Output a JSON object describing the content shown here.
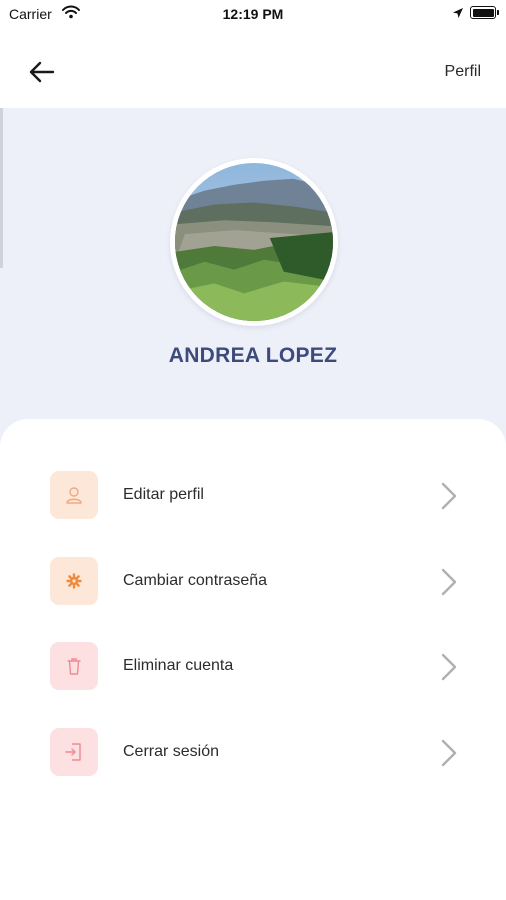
{
  "status_bar": {
    "carrier": "Carrier",
    "time": "12:19 PM",
    "icons": [
      "wifi-icon",
      "location-arrow-icon",
      "battery-icon"
    ]
  },
  "nav": {
    "back_icon": "arrow-left-icon",
    "title": "Perfil"
  },
  "profile": {
    "name": "ANDREA LOPEZ",
    "avatar": "mountain-valley-landscape-photo"
  },
  "menu": {
    "items": [
      {
        "label": "Editar perfil",
        "icon": "user-icon",
        "icon_color": "#f0a880",
        "bg_color": "#fde7d9"
      },
      {
        "label": "Cambiar contraseña",
        "icon": "gear-icon",
        "icon_color": "#f08a3e",
        "bg_color": "#fde7d9"
      },
      {
        "label": "Eliminar cuenta",
        "icon": "trash-icon",
        "icon_color": "#f08a90",
        "bg_color": "#fde0e2"
      },
      {
        "label": "Cerrar sesión",
        "icon": "logout-icon",
        "icon_color": "#f08a90",
        "bg_color": "#fde0e2"
      }
    ],
    "chevron_icon": "chevron-right-icon"
  },
  "colors": {
    "header_bg": "#eef0f9",
    "name_color": "#3d4a7c",
    "chevron": "#b0b0b0"
  }
}
